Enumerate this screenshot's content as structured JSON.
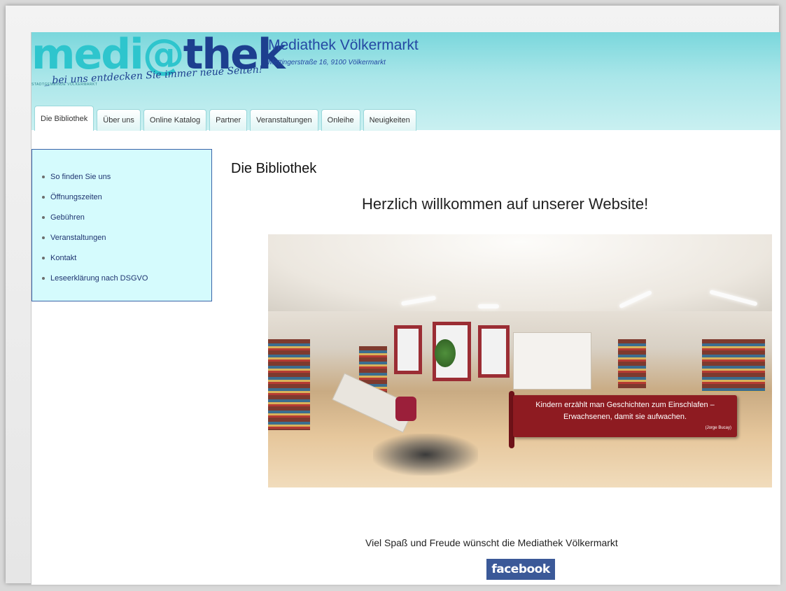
{
  "header": {
    "logo": {
      "part1": "medi",
      "part2": "@",
      "part3": "thek",
      "subtext": "STADTGEMEINDE VÖLKERMARKT"
    },
    "slogan": "_ bei uns entdecken Sie immer neue Seiten!",
    "title": "Mediathek Völkermarkt",
    "address": "Mettingerstraße 16, 9100 Völkermarkt"
  },
  "tabs": [
    {
      "label": "Die Bibliothek",
      "active": true
    },
    {
      "label": "Über uns"
    },
    {
      "label": "Online Katalog"
    },
    {
      "label": "Partner"
    },
    {
      "label": "Veranstaltungen"
    },
    {
      "label": "Onleihe"
    },
    {
      "label": "Neuigkeiten"
    }
  ],
  "sidebar": {
    "items": [
      {
        "label": "So finden Sie uns"
      },
      {
        "label": "Öffnungszeiten"
      },
      {
        "label": "Gebühren"
      },
      {
        "label": "Veranstaltungen"
      },
      {
        "label": "Kontakt"
      },
      {
        "label": "Leseerklärung nach DSGVO"
      }
    ]
  },
  "content": {
    "title": "Die Bibliothek",
    "welcome": "Herzlich willkommen auf unserer Website!",
    "quote": {
      "line1": "Kindern erzählt man Geschichten zum Einschlafen –",
      "line2": "Erwachsenen, damit sie aufwachen.",
      "author": "(Jorge Bucay)"
    },
    "footer_text": "Viel Spaß und Freude wünscht die Mediathek Völkermarkt",
    "facebook_label": "facebook"
  },
  "colors": {
    "header_gradient_top": "#7ad7dc",
    "title_blue": "#2448a3",
    "sidebar_bg": "#d5fbfd",
    "quote_bg": "#8e1b21",
    "facebook_blue": "#3b5998"
  }
}
